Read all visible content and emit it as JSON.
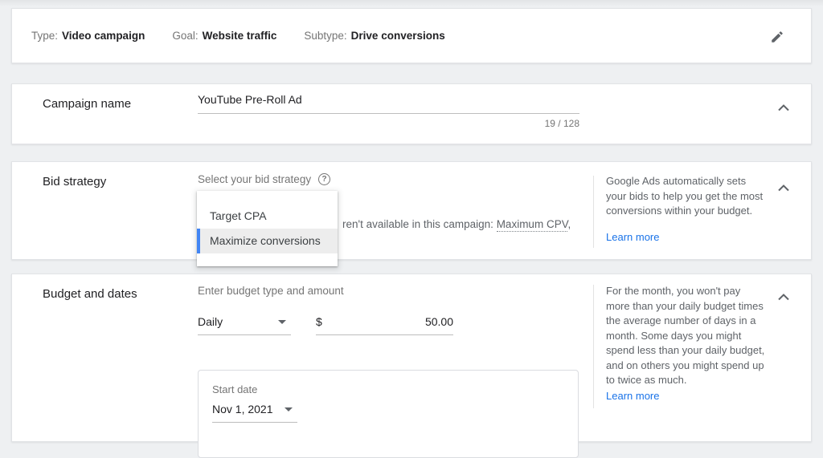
{
  "colors": {
    "link_blue": "#1a73e8",
    "selection_bar_blue": "#4285f4",
    "card_background": "#ffffff",
    "page_background": "#eef0f2"
  },
  "summary_bar": {
    "items": [
      {
        "label": "Type:",
        "value": "Video campaign"
      },
      {
        "label": "Goal:",
        "value": "Website traffic"
      },
      {
        "label": "Subtype:",
        "value": "Drive conversions"
      }
    ]
  },
  "campaign_name": {
    "title": "Campaign name",
    "value": "YouTube Pre-Roll Ad",
    "char_count": "19 / 128"
  },
  "bid_strategy": {
    "title": "Bid strategy",
    "field_label": "Select your bid strategy",
    "help_icon_glyph": "?",
    "dropdown_options": [
      {
        "label": "Target CPA"
      },
      {
        "label": "Maximize conversions"
      }
    ],
    "background_text_prefix": "ren't available in this campaign: ",
    "background_text_term": "Maximum CPV",
    "background_text_suffix": ",",
    "help_text": "Google Ads automatically sets your bids to help you get the most conversions within your budget.",
    "learn_more": "Learn more"
  },
  "budget_and_dates": {
    "title": "Budget and dates",
    "field_label": "Enter budget type and amount",
    "budget_type": "Daily",
    "currency_symbol": "$",
    "amount": "50.00",
    "help_text": "For the month, you won't pay more than your daily budget times the average number of days in a month. Some days you might spend less than your daily budget, and on others you might spend up to twice as much.",
    "learn_more": "Learn more",
    "start_date": {
      "label": "Start date",
      "value": "Nov 1, 2021"
    }
  }
}
